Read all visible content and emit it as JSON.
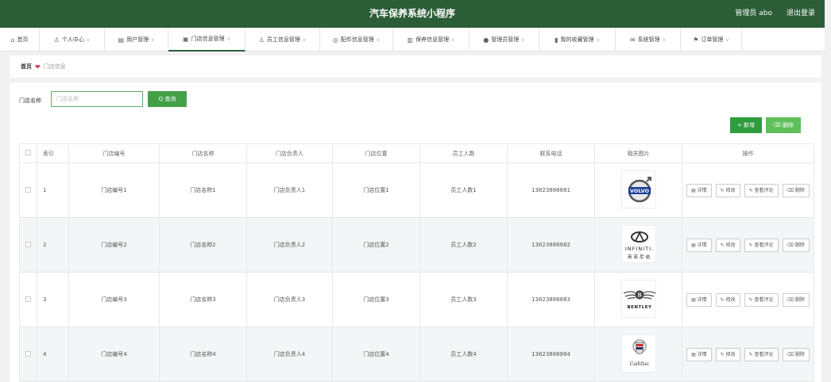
{
  "header": {
    "title": "汽车保养系统小程序",
    "user": "管理员 abo",
    "logout": "退出登录"
  },
  "nav": [
    {
      "label": "首页",
      "icon": "⌂",
      "icon_name": "home-icon",
      "chevron": false,
      "w": 50
    },
    {
      "label": "个人中心",
      "icon": "♙",
      "icon_name": "person-icon",
      "chevron": true,
      "w": 82
    },
    {
      "label": "用户管理",
      "icon": "▤",
      "icon_name": "user-list-icon",
      "chevron": true,
      "w": 80
    },
    {
      "label": "门店信息管理",
      "icon": "▣",
      "icon_name": "store-icon",
      "chevron": true,
      "w": 97,
      "active": true
    },
    {
      "label": "员工信息管理",
      "icon": "♙",
      "icon_name": "staff-icon",
      "chevron": true,
      "w": 94
    },
    {
      "label": "配件信息管理",
      "icon": "◎",
      "icon_name": "parts-icon",
      "chevron": true,
      "w": 92
    },
    {
      "label": "保养信息管理",
      "icon": "▥",
      "icon_name": "maintenance-icon",
      "chevron": true,
      "w": 96
    },
    {
      "label": "管理员管理",
      "icon": "●",
      "icon_name": "admin-icon",
      "chevron": true,
      "w": 88
    },
    {
      "label": "我的收藏管理",
      "icon": "▮",
      "icon_name": "favorites-icon",
      "chevron": true,
      "w": 96
    },
    {
      "label": "系统管理",
      "icon": "✉",
      "icon_name": "system-icon",
      "chevron": true,
      "w": 82
    },
    {
      "label": "订单管理",
      "icon": "⚑",
      "icon_name": "order-icon",
      "chevron": true,
      "w": 77
    }
  ],
  "breadcrumb": {
    "home": "首页",
    "current": "门店信息"
  },
  "search": {
    "label": "门店名称",
    "placeholder": "门店名称",
    "button": "Q 查询"
  },
  "actions": {
    "add": "+ 新增",
    "delete": "⌫ 删除"
  },
  "table": {
    "headers": [
      "",
      "索引",
      "门店编号",
      "门店名称",
      "门店负责人",
      "门店位置",
      "员工人数",
      "联系电话",
      "相关图片",
      "操作"
    ],
    "rows": [
      {
        "index": "1",
        "code": "门店编号1",
        "name": "门店名称1",
        "manager": "门店负责人1",
        "location": "门店位置1",
        "staff": "员工人数1",
        "phone": "13823888881",
        "logo": "volvo"
      },
      {
        "index": "2",
        "code": "门店编号2",
        "name": "门店名称2",
        "manager": "门店负责人2",
        "location": "门店位置2",
        "staff": "员工人数2",
        "phone": "13823888882",
        "logo": "infiniti"
      },
      {
        "index": "3",
        "code": "门店编号3",
        "name": "门店名称3",
        "manager": "门店负责人3",
        "location": "门店位置3",
        "staff": "员工人数3",
        "phone": "13823888883",
        "logo": "bentley"
      },
      {
        "index": "4",
        "code": "门店编号4",
        "name": "门店名称4",
        "manager": "门店负责人4",
        "location": "门店位置4",
        "staff": "员工人数4",
        "phone": "13823888884",
        "logo": "cadillac"
      }
    ],
    "ops": {
      "detail": "▤ 详情",
      "edit": "✎ 修改",
      "review": "✎ 查看评论",
      "delete": "⌫ 删除"
    }
  },
  "logo_text": {
    "volvo": "VOLVO",
    "infiniti": "INFINITI.",
    "infiniti_cn": "英菲尼迪",
    "bentley": "BENTLEY",
    "cadillac": "Cadillac"
  }
}
